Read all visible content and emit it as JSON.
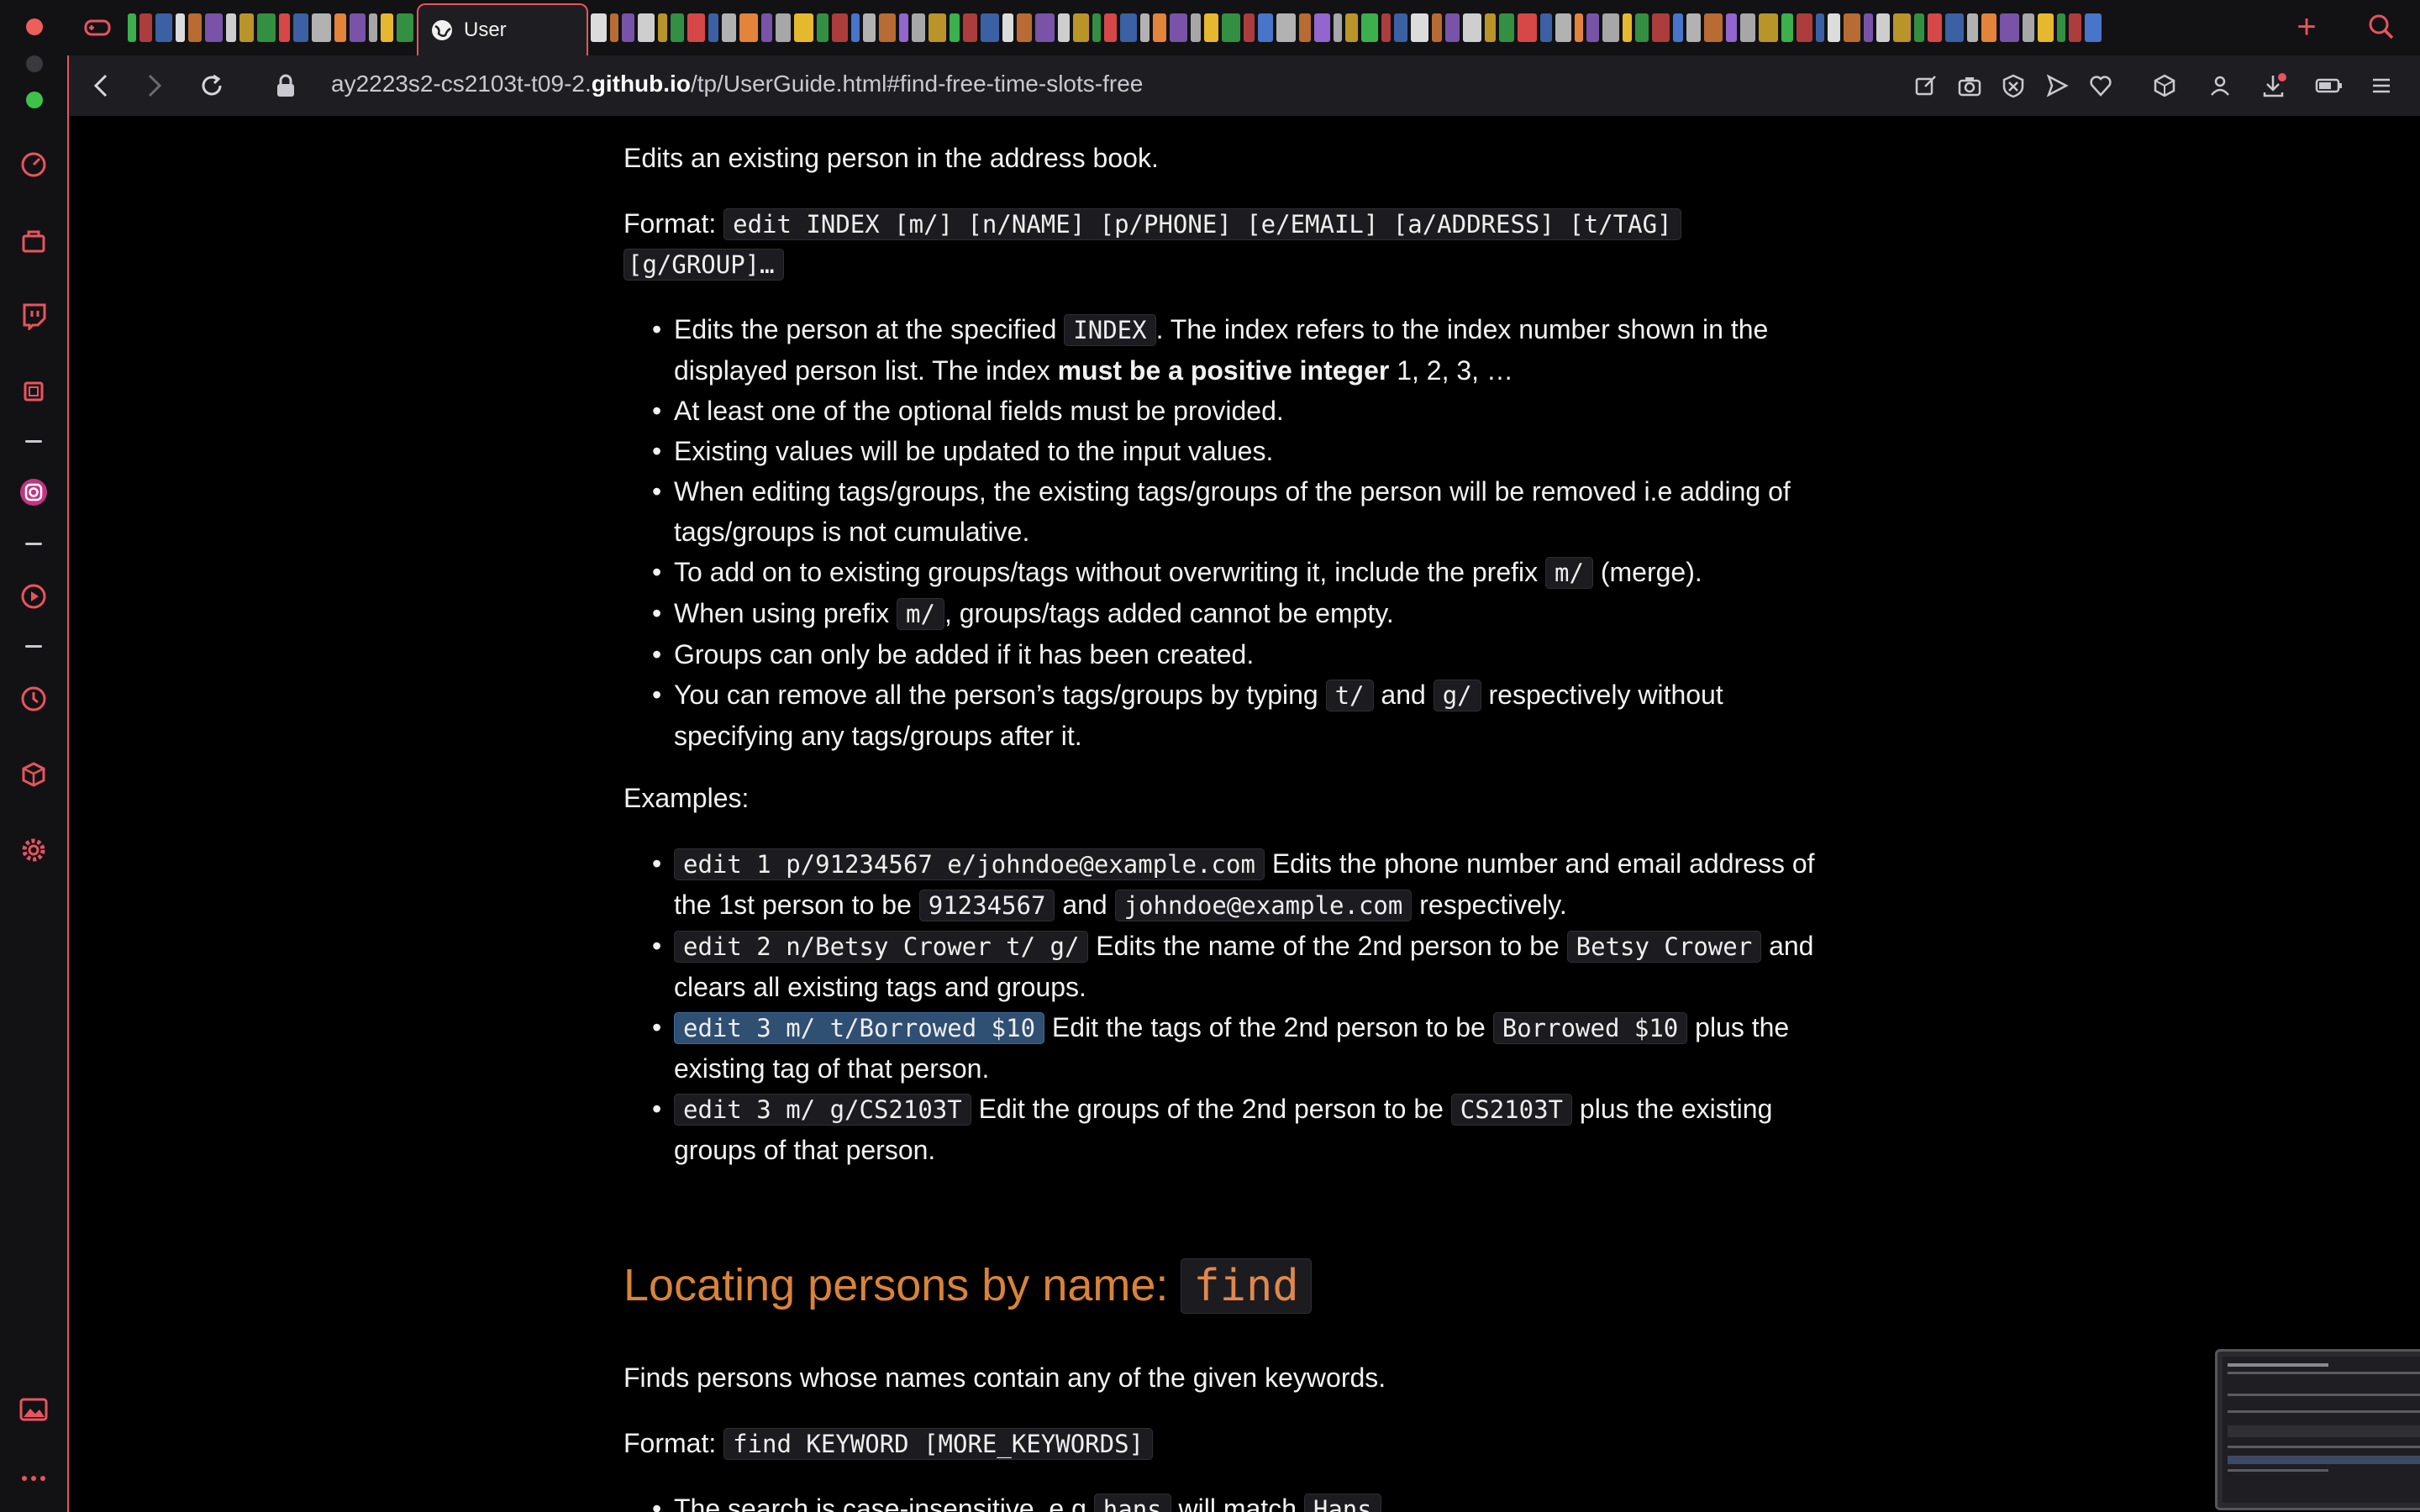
{
  "browser": {
    "active_tab_title": "User",
    "url_domain_prefix": "ay2223s2-cs2103t-t09-2.",
    "url_domain_bold": "github.io",
    "url_path": "/tp/UserGuide.html#find-free-time-slots-free",
    "accent_color": "#e8545f",
    "sidebar_icons": [
      "speed-dial-icon",
      "shopping-icon",
      "twitch-icon",
      "memory-icon",
      "instagram-icon",
      "player-icon",
      "history-icon",
      "extensions-icon",
      "settings-icon",
      "gallery-icon",
      "more-icon"
    ],
    "toolbar_icons": [
      "edit-snapshot-icon",
      "camera-icon",
      "adblock-icon",
      "send-icon",
      "heart-icon",
      "cube-icon",
      "account-icon",
      "download-icon",
      "battery-icon",
      "menu-icon"
    ],
    "new_tab_symbol": "+"
  },
  "doc": {
    "intro": "Edits an existing person in the address book.",
    "format_label": "Format:",
    "format_code_1": "edit INDEX [m/] [n/NAME] [p/PHONE] [e/EMAIL] [a/ADDRESS] [t/TAG]",
    "format_code_2": "[g/GROUP]…",
    "bullets": {
      "b1_pre": "Edits the person at the specified ",
      "b1_code": "INDEX",
      "b1_post": ". The index refers to the index number shown in the",
      "b1_line2_pre": "displayed person list. The index ",
      "b1_line2_bold": "must be a positive integer",
      "b1_line2_post": " 1, 2, 3, …",
      "b2": "At least one of the optional fields must be provided.",
      "b3": "Existing values will be updated to the input values.",
      "b4_l1": "When editing tags/groups, the existing tags/groups of the person will be removed i.e adding of",
      "b4_l2": "tags/groups is not cumulative.",
      "b5_pre": "To add on to existing groups/tags without overwriting it, include the prefix ",
      "b5_code": "m/",
      "b5_post": " (merge).",
      "b6_pre": "When using prefix ",
      "b6_code": "m/",
      "b6_post": ", groups/tags added cannot be empty.",
      "b7": "Groups can only be added if it has been created.",
      "b8_pre": "You can remove all the person’s tags/groups by typing ",
      "b8_code1": "t/",
      "b8_mid": " and ",
      "b8_code2": "g/",
      "b8_post": " respectively without",
      "b8_l2": "specifying any tags/groups after it."
    },
    "examples_label": "Examples:",
    "examples": {
      "e1_code": "edit 1 p/91234567 e/johndoe@example.com",
      "e1_text": " Edits the phone number and email address of",
      "e1_l2_pre": "the 1st person to be ",
      "e1_l2_code1": "91234567",
      "e1_l2_mid": " and ",
      "e1_l2_code2": "johndoe@example.com",
      "e1_l2_post": " respectively.",
      "e2_code": "edit 2 n/Betsy Crower t/ g/",
      "e2_text": " Edits the name of the 2nd person to be ",
      "e2_code2": "Betsy Crower",
      "e2_post": " and",
      "e2_l2": "clears all existing tags and groups.",
      "e3_code": "edit 3 m/ t/Borrowed $10",
      "e3_text": " Edit the tags of the 2nd person to be ",
      "e3_code2": "Borrowed $10",
      "e3_post": " plus the",
      "e3_l2": "existing tag of that person.",
      "e4_code": "edit 3 m/ g/CS2103T",
      "e4_text": " Edit the groups of the 2nd person to be ",
      "e4_code2": "CS2103T",
      "e4_post": " plus the existing",
      "e4_l2": "groups of that person."
    },
    "find_heading": "Locating persons by name: ",
    "find_heading_code": "find",
    "find_desc": "Finds persons whose names contain any of the given keywords.",
    "find_format_label": "Format:",
    "find_format_code": "find KEYWORD [MORE_KEYWORDS]",
    "find_bullet_pre": "The search is case-insensitive. e.g ",
    "find_bullet_code1": "hans",
    "find_bullet_mid": " will match ",
    "find_bullet_code2": "Hans"
  }
}
